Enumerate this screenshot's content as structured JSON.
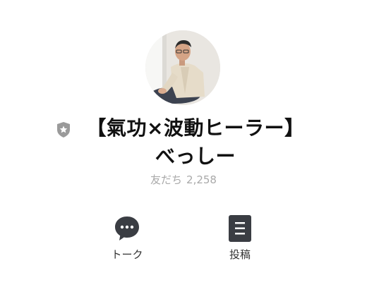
{
  "profile": {
    "name": "【氣功×波動ヒーラー】べっしー",
    "friends_label": "友だち",
    "friends_count": "2,258",
    "badge_icon": "shield-star-icon",
    "avatar_icon": "profile-photo"
  },
  "actions": {
    "talk_label": "トーク",
    "talk_icon": "chat-bubble-icon",
    "posts_label": "投稿",
    "posts_icon": "document-icon"
  },
  "colors": {
    "icon_dark": "#3a3d43",
    "badge_gray": "#9a9a9a",
    "muted_text": "#a9a9a9"
  }
}
